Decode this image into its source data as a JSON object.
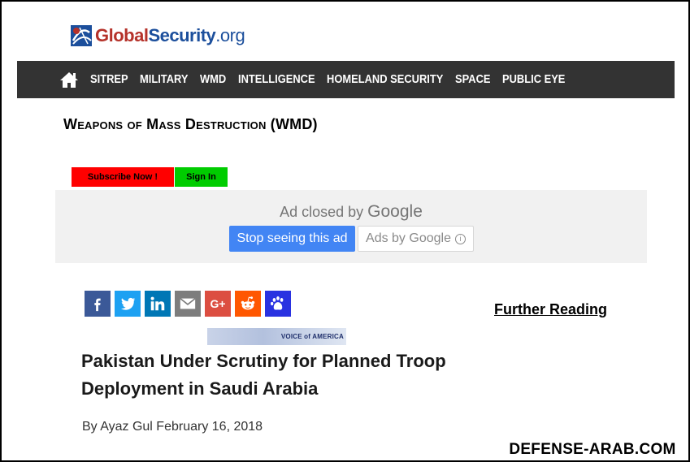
{
  "logo": {
    "part1": "Global",
    "part2": "Security",
    "part3": ".org"
  },
  "nav": {
    "home_icon": "home-icon",
    "items": [
      "SITREP",
      "MILITARY",
      "WMD",
      "INTELLIGENCE",
      "HOMELAND SECURITY",
      "SPACE",
      "PUBLIC EYE"
    ]
  },
  "section_title": "Weapons of Mass Destruction (WMD)",
  "account": {
    "subscribe": "Subscribe Now !",
    "signin": "Sign In"
  },
  "ad": {
    "closed_by": "Ad closed by",
    "google": "Google",
    "stop_button": "Stop seeing this ad",
    "ads_by": "Ads by Google",
    "info_icon": "info-icon"
  },
  "social": [
    "facebook-icon",
    "twitter-icon",
    "linkedin-icon",
    "email-icon",
    "google-plus-icon",
    "reddit-icon",
    "baidu-icon"
  ],
  "social_gplus_text": "G+",
  "further_reading": "Further Reading",
  "voa": {
    "text": "VOICE of AMERICA"
  },
  "article": {
    "headline": "Pakistan Under Scrutiny for Planned Troop Deployment in Saudi Arabia",
    "byline": "By Ayaz Gul February 16, 2018"
  },
  "watermark": "DEFENSE-ARAB.COM",
  "colors": {
    "nav_bg": "#333333",
    "subscribe_bg": "#ff0000",
    "signin_bg": "#00cc00",
    "stop_btn": "#4285f4",
    "ad_panel": "#f1f1f1"
  }
}
